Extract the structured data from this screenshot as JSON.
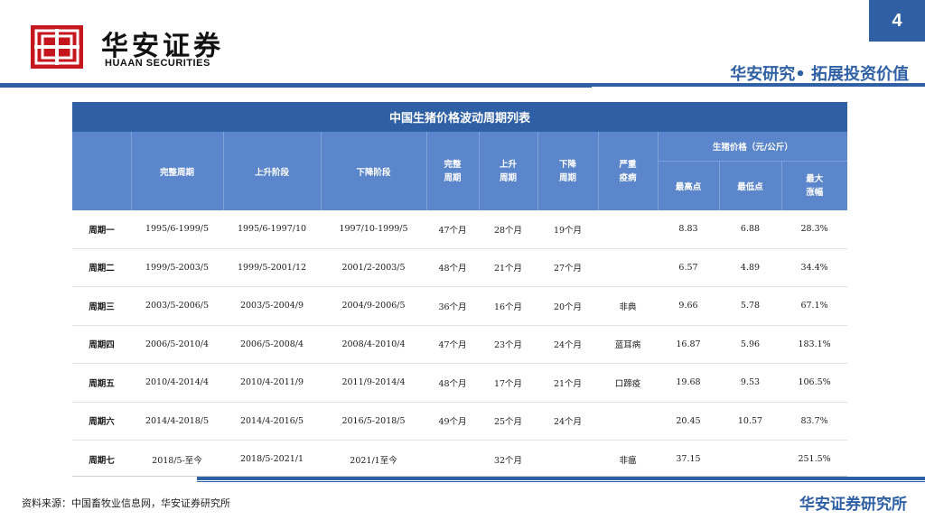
{
  "header": {
    "logo_icon": "huaan-logo-icon",
    "brand_cn": "华安证券",
    "brand_en": "HUAAN SECURITIES",
    "page_number": "4",
    "tagline": "华安研究• 拓展投资价值",
    "accent_color": "#2f60a6",
    "logo_color": "#c4161c"
  },
  "table": {
    "title": "中国生猪价格波动周期列表",
    "headers": {
      "full_cycle": "完整周期",
      "rise_stage": "上升阶段",
      "fall_stage": "下降阶段",
      "full_period": "完整周期",
      "rise_period": "上升周期",
      "fall_period": "下降周期",
      "disease": "严重疫病",
      "price_group": "生猪价格（元/公斤）",
      "max_price": "最高点",
      "min_price": "最低点",
      "max_gain": "最大涨幅"
    },
    "rows": [
      {
        "cycle": "周期一",
        "full": "1995/6-1999/5",
        "rise": "1995/6-1997/10",
        "fall": "1997/10-1999/5",
        "full_m": "47个月",
        "rise_m": "28个月",
        "fall_m": "19个月",
        "disease": "",
        "high": "8.83",
        "low": "6.88",
        "gain": "28.3%"
      },
      {
        "cycle": "周期二",
        "full": "1999/5-2003/5",
        "rise": "1999/5-2001/12",
        "fall": "2001/2-2003/5",
        "full_m": "48个月",
        "rise_m": "21个月",
        "fall_m": "27个月",
        "disease": "",
        "high": "6.57",
        "low": "4.89",
        "gain": "34.4%"
      },
      {
        "cycle": "周期三",
        "full": "2003/5-2006/5",
        "rise": "2003/5-2004/9",
        "fall": "2004/9-2006/5",
        "full_m": "36个月",
        "rise_m": "16个月",
        "fall_m": "20个月",
        "disease": "非典",
        "high": "9.66",
        "low": "5.78",
        "gain": "67.1%"
      },
      {
        "cycle": "周期四",
        "full": "2006/5-2010/4",
        "rise": "2006/5-2008/4",
        "fall": "2008/4-2010/4",
        "full_m": "47个月",
        "rise_m": "23个月",
        "fall_m": "24个月",
        "disease": "蓝耳病",
        "high": "16.87",
        "low": "5.96",
        "gain": "183.1%"
      },
      {
        "cycle": "周期五",
        "full": "2010/4-2014/4",
        "rise": "2010/4-2011/9",
        "fall": "2011/9-2014/4",
        "full_m": "48个月",
        "rise_m": "17个月",
        "fall_m": "21个月",
        "disease": "口蹄疫",
        "high": "19.68",
        "low": "9.53",
        "gain": "106.5%"
      },
      {
        "cycle": "周期六",
        "full": "2014/4-2018/5",
        "rise": "2014/4-2016/5",
        "fall": "2016/5-2018/5",
        "full_m": "49个月",
        "rise_m": "25个月",
        "fall_m": "24个月",
        "disease": "",
        "high": "20.45",
        "low": "10.57",
        "gain": "83.7%"
      },
      {
        "cycle": "周期七",
        "full": "2018/5-至今",
        "rise": "2018/5-2021/1",
        "fall": "2021/1至今",
        "full_m": "",
        "rise_m": "32个月",
        "fall_m": "",
        "disease": "非瘟",
        "high": "37.15",
        "low": "",
        "gain": "251.5%"
      }
    ]
  },
  "footer": {
    "source": "资料来源：中国畜牧业信息网，华安证券研究所",
    "brand": "华安证券研究所"
  }
}
